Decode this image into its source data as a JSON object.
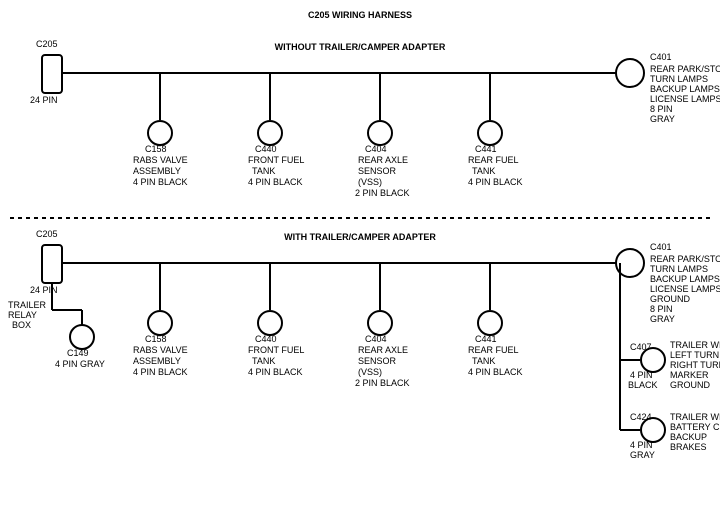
{
  "title": "C205 WIRING HARNESS",
  "section1": {
    "label": "WITHOUT  TRAILER/CAMPER  ADAPTER"
  },
  "section2": {
    "label": "WITH  TRAILER/CAMPER  ADAPTER"
  },
  "connectors_top": {
    "c205": {
      "id": "C205",
      "pins": "24 PIN"
    },
    "c401": {
      "id": "C401",
      "pins": "8 PIN",
      "color": "GRAY",
      "desc": "REAR PARK/STOP\nTURN LAMPS\nBACKUP LAMPS\nLICENSE LAMPS"
    },
    "c158": {
      "id": "C158",
      "desc": "RABS VALVE\nASSEMBLY\n4 PIN BLACK"
    },
    "c440": {
      "id": "C440",
      "desc": "FRONT FUEL\nTANK\n4 PIN BLACK"
    },
    "c404": {
      "id": "C404",
      "desc": "REAR AXLE\nSENSOR\n(VSS)\n2 PIN BLACK"
    },
    "c441": {
      "id": "C441",
      "desc": "REAR FUEL\nTANK\n4 PIN BLACK"
    }
  },
  "connectors_bottom": {
    "c205": {
      "id": "C205",
      "pins": "24 PIN"
    },
    "c401": {
      "id": "C401",
      "pins": "8 PIN",
      "color": "GRAY",
      "desc": "REAR PARK/STOP\nTURN LAMPS\nBACKUP LAMPS\nLICENSE LAMPS\nGROUND"
    },
    "c158": {
      "id": "C158",
      "desc": "RABS VALVE\nASSEMBLY\n4 PIN BLACK"
    },
    "c440": {
      "id": "C440",
      "desc": "FRONT FUEL\nTANK\n4 PIN BLACK"
    },
    "c404": {
      "id": "C404",
      "desc": "REAR AXLE\nSENSOR\n(VSS)\n2 PIN BLACK"
    },
    "c441": {
      "id": "C441",
      "desc": "REAR FUEL\nTANK\n4 PIN BLACK"
    },
    "c149": {
      "id": "C149",
      "desc": "4 PIN GRAY"
    },
    "c407": {
      "id": "C407",
      "desc": "4 PIN\nBLACK",
      "label": "TRAILER WIRES\nLEFT TURN\nRIGHT TURN\nMARKER\nGROUND"
    },
    "c424": {
      "id": "C424",
      "desc": "4 PIN\nGRAY",
      "label": "TRAILER WIRES\nBATTERY CHARGE\nBACKUP\nBRAKES"
    }
  }
}
